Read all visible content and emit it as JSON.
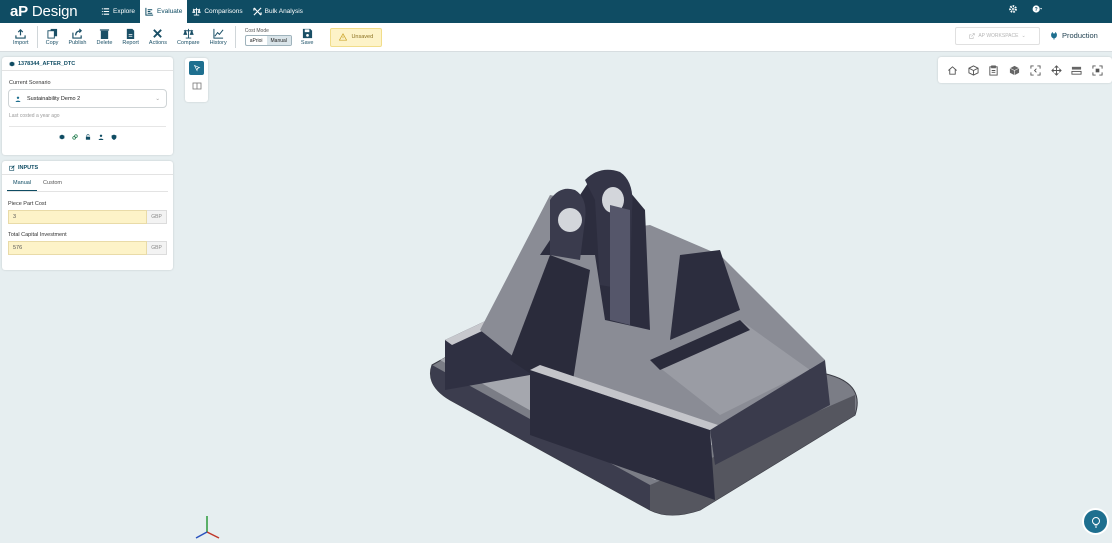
{
  "app": {
    "logo_bold": "aP",
    "logo_rest": " Design"
  },
  "nav": [
    {
      "label": "Explore",
      "icon": "list-icon",
      "active": false
    },
    {
      "label": "Evaluate",
      "icon": "evaluate-icon",
      "active": true
    },
    {
      "label": "Comparisons",
      "icon": "scale-icon",
      "active": false
    },
    {
      "label": "Bulk Analysis",
      "icon": "bulk-icon",
      "active": false
    }
  ],
  "toolbar": {
    "import": "Import",
    "copy": "Copy",
    "publish": "Publish",
    "delete": "Delete",
    "report": "Report",
    "actions": "Actions",
    "compare": "Compare",
    "history": "History",
    "cost_mode_label": "Cost Mode",
    "cost_mode_options": [
      "aPrioi",
      "Manual"
    ],
    "cost_mode_selected": "Manual",
    "save": "Save",
    "unsaved": "Unsaved",
    "workspace": "AP WORKSPACE",
    "production": "Production"
  },
  "scenario_panel": {
    "part_name": "1378344_AFTER_DTC",
    "current_scenario_label": "Current Scenario",
    "scenario_name": "Sustainability Demo 2",
    "last_costed": "Last costed a year ago",
    "icons": [
      "cube-icon",
      "link-icon",
      "lock-icon",
      "user-icon",
      "shield-icon"
    ]
  },
  "inputs_panel": {
    "title": "INPUTS",
    "tabs": [
      "Manual",
      "Custom"
    ],
    "active_tab": "Manual",
    "piece_part_cost_label": "Piece Part Cost",
    "piece_part_cost_value": "3",
    "piece_part_cost_unit": "GBP",
    "capital_investment_label": "Total Capital Investment",
    "capital_investment_value": "576",
    "capital_investment_unit": "GBP"
  },
  "view_tools": [
    "home-view-icon",
    "iso-cube-icon",
    "clipboard-icon",
    "solid-cube-icon",
    "fit-view-icon",
    "explode-icon",
    "layers-icon",
    "screenshot-icon"
  ],
  "colors": {
    "nav_bg": "#0f4c63",
    "accent": "#1e6f8f",
    "unsaved_bg": "#fdf3c8"
  }
}
